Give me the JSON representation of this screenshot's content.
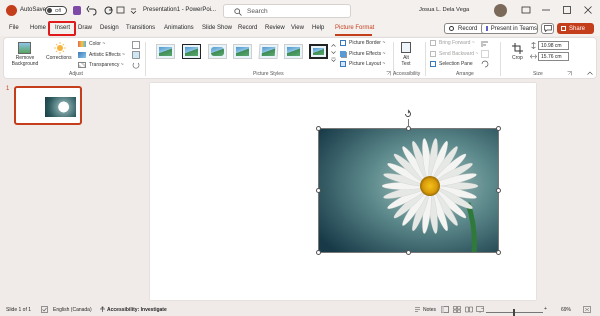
{
  "titlebar": {
    "autosave_label": "AutoSave",
    "autosave_state": "Off",
    "doc_title": "Presentation1 - PowerPoi...",
    "search_placeholder": "Search",
    "user_name": "Josua L. Dela Vega"
  },
  "tabs": [
    "File",
    "Home",
    "Insert",
    "Draw",
    "Design",
    "Transitions",
    "Animations",
    "Slide Show",
    "Record",
    "Review",
    "View",
    "Help",
    "Picture Format"
  ],
  "active_tab": "Picture Format",
  "highlighted_tab": "Insert",
  "top_buttons": {
    "record": "Record",
    "present_teams": "Present in Teams",
    "share": "Share"
  },
  "ribbon": {
    "remove_background": "Remove Background",
    "corrections": "Corrections",
    "color": "Color ~",
    "artistic_effects": "Artistic Effects ~",
    "transparency": "Transparency ~",
    "adjust_label": "Adjust",
    "picture_styles_label": "Picture Styles",
    "picture_border": "Picture Border ~",
    "picture_effects": "Picture Effects ~",
    "picture_layout": "Picture Layout ~",
    "alt_text": "Alt Text",
    "accessibility_label": "Accessibility",
    "bring_forward": "Bring Forward ~",
    "send_backward": "Send Backward ~",
    "selection_pane": "Selection Pane",
    "arrange_label": "Arrange",
    "crop": "Crop",
    "height_value": "10.98 cm",
    "width_value": "15.76 cm",
    "size_label": "Size"
  },
  "slides_pane": {
    "slide_number": "1"
  },
  "statusbar": {
    "slide_info": "Slide 1 of 1",
    "language": "English (Canada)",
    "accessibility": "Accessibility: Investigate",
    "notes": "Notes",
    "zoom": "69%"
  },
  "colors": {
    "accent": "#c43e1c",
    "highlight_box": "#e0191b",
    "titlebar_bg": "#f3f0ee",
    "workspace_bg": "#f0ebe9"
  }
}
